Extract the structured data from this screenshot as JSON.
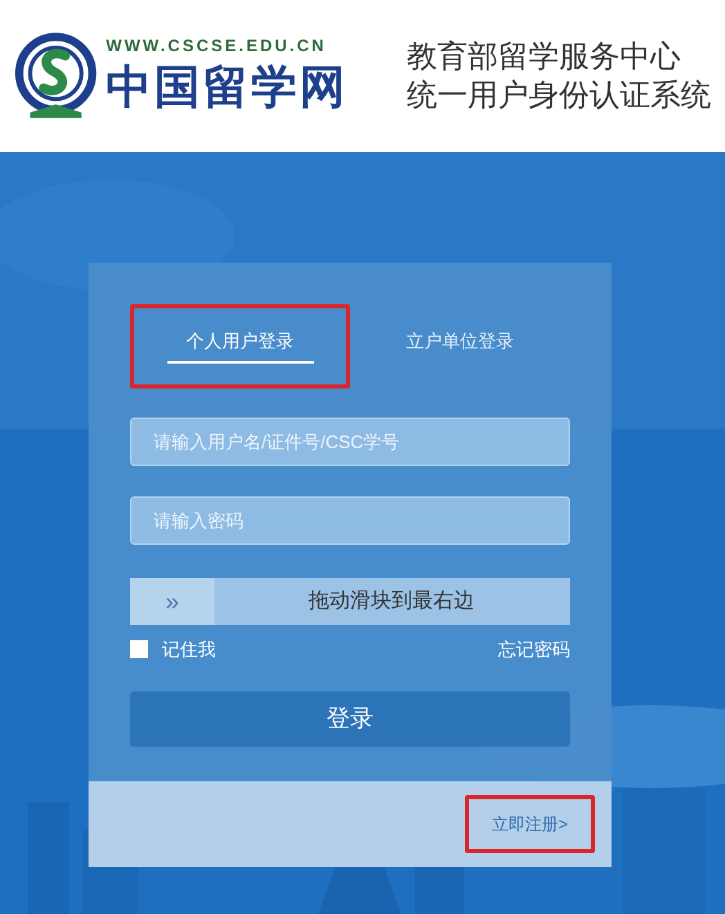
{
  "header": {
    "site_url": "WWW.CSCSE.EDU.CN",
    "site_name": "中国留学网",
    "title_lines": [
      "教育部留学服务中心",
      "统一用户身份认证系统"
    ]
  },
  "login_card": {
    "tabs": [
      {
        "label": "个人用户登录",
        "selected": true,
        "highlighted": true
      },
      {
        "label": "立户单位登录",
        "selected": false,
        "highlighted": false
      }
    ],
    "fields": [
      {
        "placeholder": "请输入用户名/证件号/CSC学号"
      },
      {
        "placeholder": "请输入密码"
      }
    ],
    "slider": {
      "handle": "»",
      "label": "拖动滑块到最右边",
      "level": 0
    },
    "remember_me": {
      "label": "记住我",
      "checked": false
    },
    "forgot_link": "忘记密码",
    "login_button": "登录",
    "register_link": {
      "label": "立即注册>",
      "highlighted": true
    }
  }
}
